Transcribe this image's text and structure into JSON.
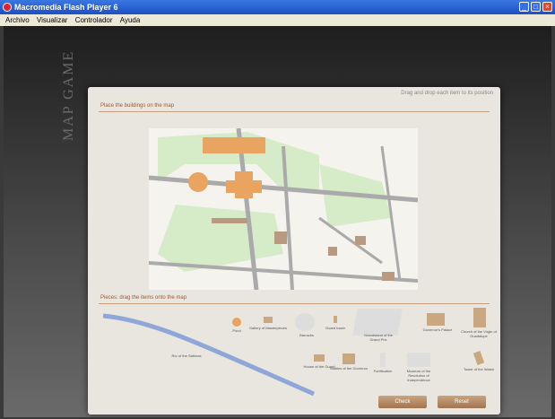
{
  "window": {
    "title": "Macromedia Flash Player 6"
  },
  "menu": {
    "items": [
      "Archivo",
      "Visualizar",
      "Controlador",
      "Ayuda"
    ]
  },
  "game": {
    "side_title": "MAP GAME",
    "instructions_hint": "Drag and drop each item to its position",
    "map_section_title": "Place the buildings on the map",
    "pieces_section_title": "Pieces: drag the items onto the map",
    "pieces": [
      {
        "id": "pond",
        "label": "Pond"
      },
      {
        "id": "gallery",
        "label": "Gallery of Masterpieces"
      },
      {
        "id": "barracks",
        "label": "Barracks"
      },
      {
        "id": "small",
        "label": "Guard tower"
      },
      {
        "id": "grandstand",
        "label": "Grandstand of the Grand Prix"
      },
      {
        "id": "palace",
        "label": "Governor's Palace"
      },
      {
        "id": "church",
        "label": "Church of the Virgin of Guadalupe"
      },
      {
        "id": "river",
        "label": "Río of the Sabinas"
      },
      {
        "id": "guardhouse",
        "label": "House of the Guard"
      },
      {
        "id": "stables",
        "label": "Stables of the Governor"
      },
      {
        "id": "wall",
        "label": "Fortification"
      },
      {
        "id": "museum",
        "label": "Museum of the Revolution of Independence"
      },
      {
        "id": "tower",
        "label": "Tower of the Watch"
      }
    ],
    "buttons": {
      "check": "Check",
      "reset": "Reset"
    }
  }
}
